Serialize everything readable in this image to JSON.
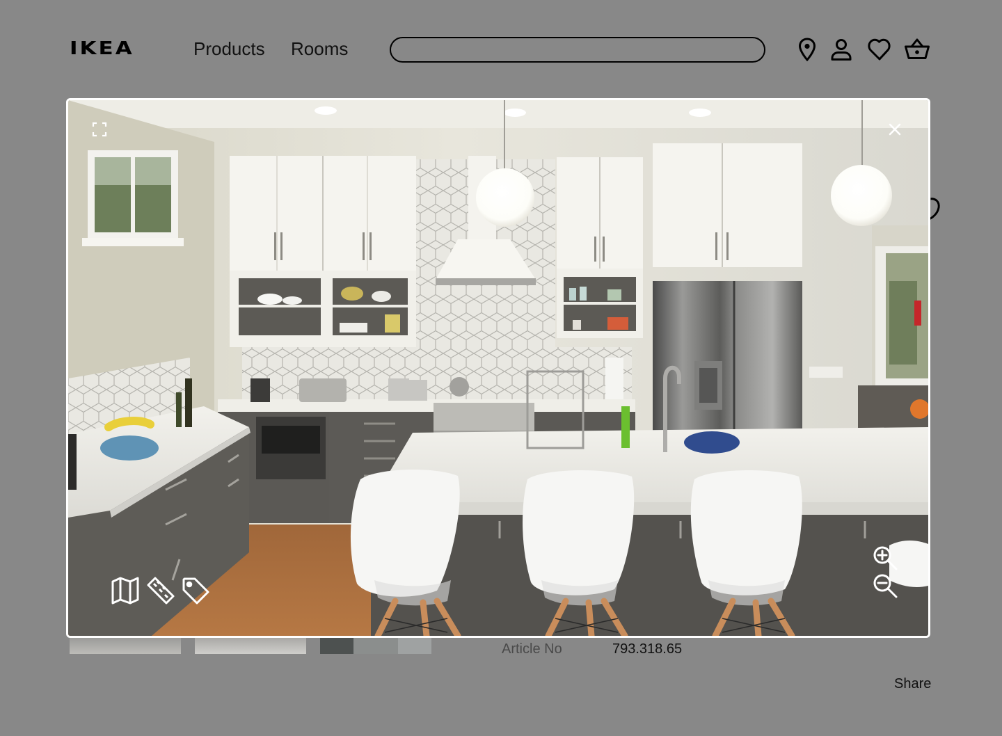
{
  "header": {
    "logo": "IKEA",
    "nav": [
      "Products",
      "Rooms"
    ],
    "search_placeholder": "",
    "icons": [
      "location-pin-icon",
      "user-icon",
      "heart-icon",
      "basket-icon"
    ]
  },
  "product_details": {
    "article_label": "Article No",
    "article_value": "793.318.65",
    "share_label": "Share"
  },
  "image_viewer": {
    "image_subject": "kitchen-island-photo",
    "controls": [
      "expand-icon",
      "close-icon",
      "map-icon",
      "ruler-icon",
      "tag-icon",
      "zoom-in-icon",
      "zoom-out-icon"
    ]
  },
  "colors": {
    "page_overlay": "#888888",
    "modal_border": "#ffffff",
    "icon_color": "#ffffff",
    "text": "#111111"
  }
}
